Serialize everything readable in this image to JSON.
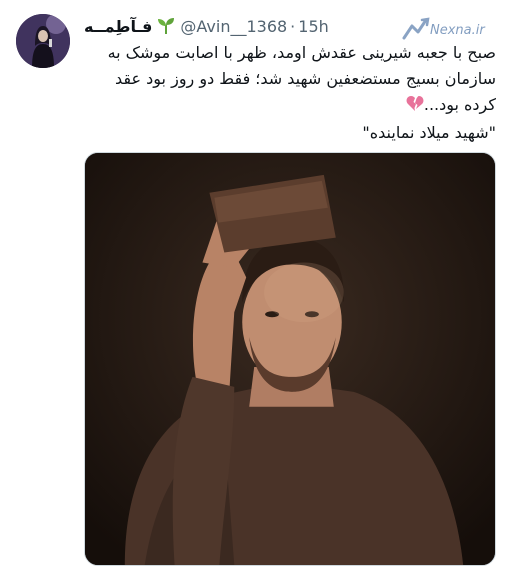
{
  "tweet": {
    "display_name": "فـآطِمــه",
    "handle": "@Avin__1368",
    "separator": "·",
    "time": "15h",
    "text_lines": [
      "صبح با جعبه شیرینی عقدش اومد، ظهر با اصابت موشک به",
      "سازمان بسیج مستضعفین شهید شد؛ فقط دو روز بود عقد",
      "کرده بود...",
      "\"شهید میلاد نماینده\""
    ]
  },
  "watermark": {
    "text": "Nexna.ir"
  },
  "icons": {
    "name_badge": "sprout-icon",
    "emoji": "broken-heart-icon",
    "watermark_logo": "nexna-logo-icon"
  },
  "colors": {
    "text": "#0f1419",
    "secondary": "#536471",
    "sprout": "#5fa33a",
    "heart": "#e8729a",
    "watermark": "#6d8db6"
  }
}
